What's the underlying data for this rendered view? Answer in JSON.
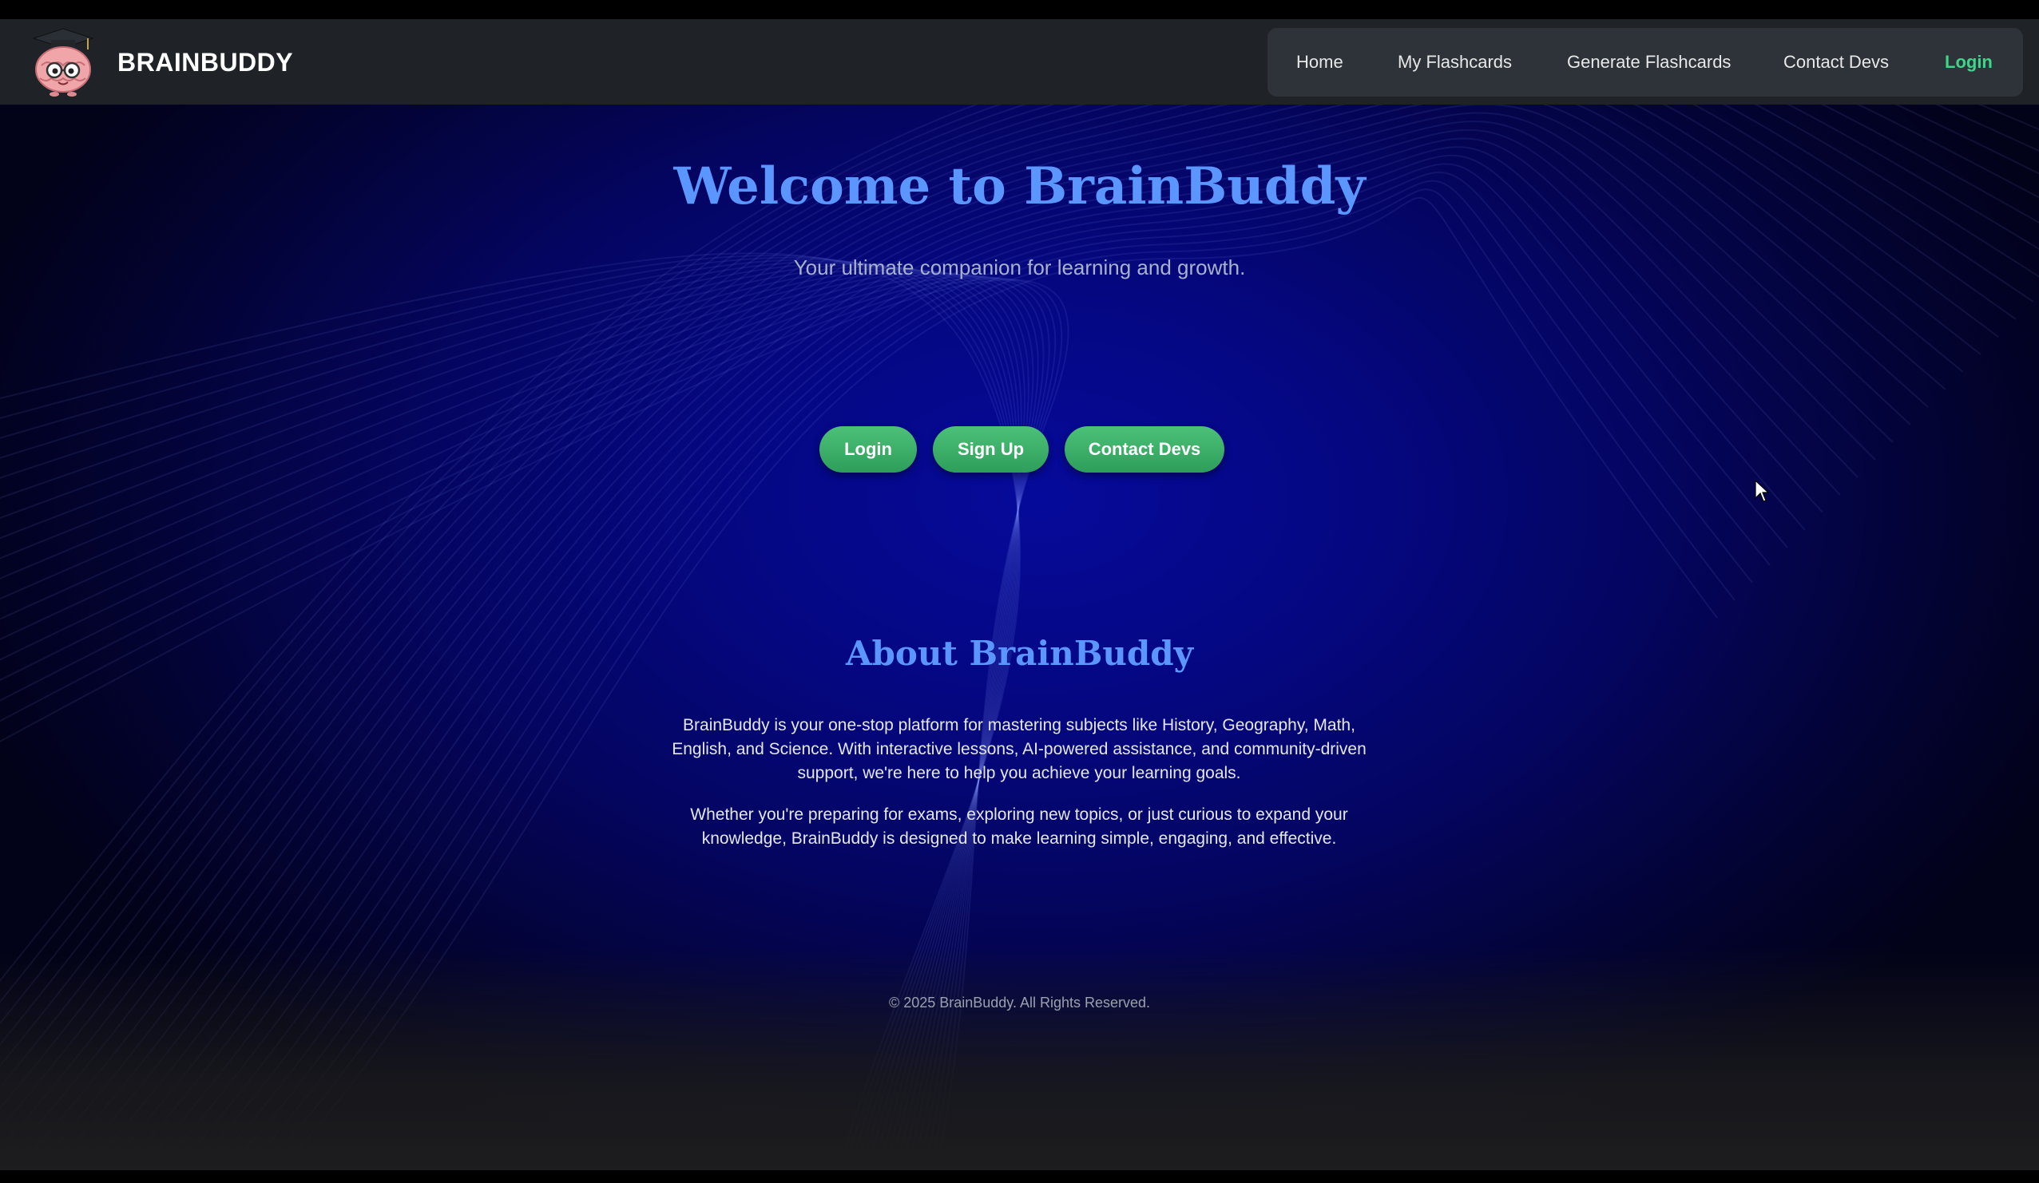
{
  "header": {
    "brand": "BRAINBUDDY",
    "logo_icon": "brain-mascot-graduation-cap-icon",
    "nav": {
      "home": "Home",
      "my_flashcards": "My Flashcards",
      "generate_flashcards": "Generate Flashcards",
      "contact_devs": "Contact Devs",
      "login": "Login"
    }
  },
  "hero": {
    "title": "Welcome to BrainBuddy",
    "subtitle": "Your ultimate companion for learning and growth.",
    "buttons": {
      "login": "Login",
      "signup": "Sign Up",
      "contact": "Contact Devs"
    }
  },
  "about": {
    "title": "About BrainBuddy",
    "p1": "BrainBuddy is your one-stop platform for mastering subjects like History, Geography, Math, English, and Science. With interactive lessons, AI-powered assistance, and community-driven support, we're here to help you achieve your learning goals.",
    "p2": "Whether you're preparing for exams, exploring new topics, or just curious to expand your knowledge, BrainBuddy is designed to make learning simple, engaging, and effective."
  },
  "footer": {
    "copyright": "© 2025 BrainBuddy. All Rights Reserved."
  },
  "colors": {
    "accent_blue": "#5b96ff",
    "accent_green": "#3fd68a",
    "button_green": "#36a862",
    "header_bg": "#1f2327",
    "nav_bg": "#2d3339",
    "page_bg": "#050780"
  }
}
